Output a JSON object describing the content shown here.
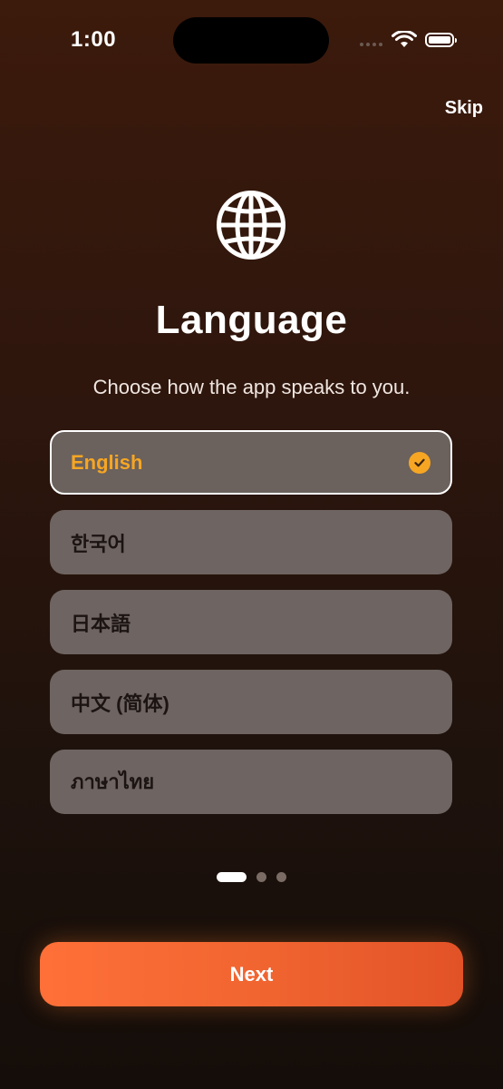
{
  "status_bar": {
    "time": "1:00"
  },
  "header": {
    "skip_label": "Skip"
  },
  "icon": "globe-icon",
  "title": "Language",
  "subtitle": "Choose how the app speaks to you.",
  "languages": [
    {
      "label": "English",
      "selected": true
    },
    {
      "label": "한국어",
      "selected": false
    },
    {
      "label": "日本語",
      "selected": false
    },
    {
      "label": "中文 (简体)",
      "selected": false
    },
    {
      "label": "ภาษาไทย",
      "selected": false
    }
  ],
  "pagination": {
    "current": 1,
    "total": 3
  },
  "next_label": "Next",
  "colors": {
    "accent": "#f6a623",
    "button": "#f06430",
    "option_bg": "#6e6461"
  }
}
